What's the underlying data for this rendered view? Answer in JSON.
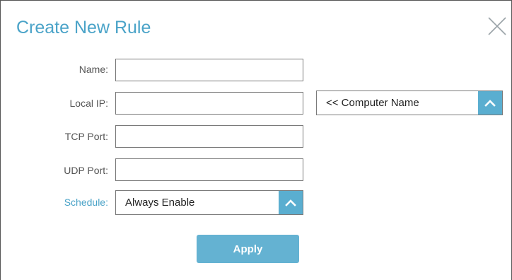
{
  "dialog": {
    "title": "Create New Rule"
  },
  "form": {
    "name_label": "Name:",
    "name_value": "",
    "local_ip_label": "Local IP:",
    "local_ip_value": "",
    "computer_name_select": "<< Computer Name",
    "tcp_port_label": "TCP Port:",
    "tcp_port_value": "",
    "udp_port_label": "UDP Port:",
    "udp_port_value": "",
    "schedule_label": "Schedule:",
    "schedule_value": "Always Enable"
  },
  "actions": {
    "apply_label": "Apply"
  },
  "colors": {
    "accent": "#4aa3c8",
    "button": "#64b2d2",
    "select_arrow_bg": "#5aaed0"
  },
  "icons": {
    "close": "close-icon",
    "dropdown": "chevron-up-icon"
  }
}
